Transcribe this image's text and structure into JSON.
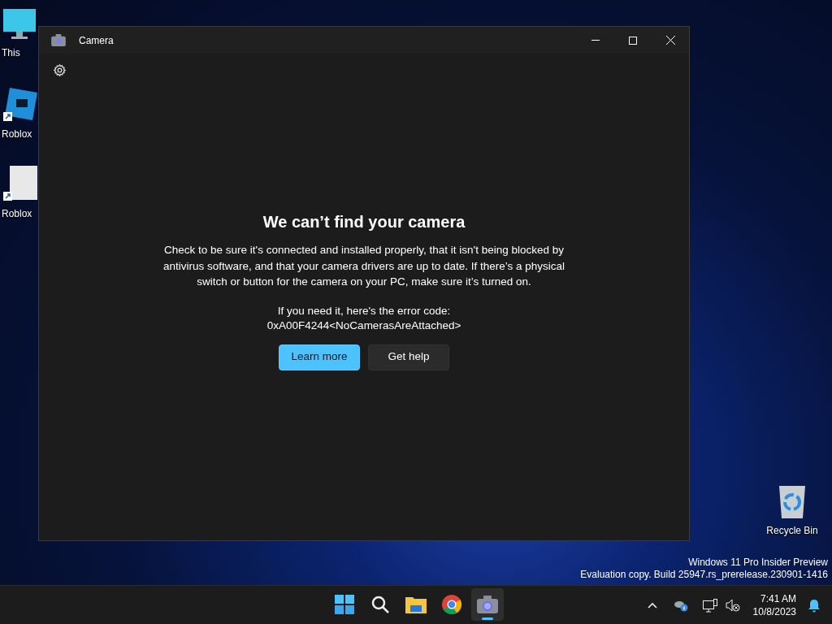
{
  "desktop_icons": [
    {
      "kind": "computer",
      "label": "This"
    },
    {
      "kind": "studio",
      "label": "Roblox"
    },
    {
      "kind": "player",
      "label": "Roblox"
    },
    {
      "kind": "bin",
      "label": "Recycle Bin"
    }
  ],
  "window": {
    "title": "Camera",
    "error": {
      "heading": "We can’t find your camera",
      "message": "Check to be sure it's connected and installed properly, that it isn't being blocked by antivirus software, and that your camera drivers are up to date. If there’s a physical switch or button for the camera on your PC, make sure it’s turned on.",
      "code_intro": "If you need it, here's the error code:",
      "code": "0xA00F4244<NoCamerasAreAttached>"
    },
    "buttons": [
      {
        "kind": "primary",
        "label": "Learn more"
      },
      {
        "kind": "secondary",
        "label": "Get help"
      }
    ]
  },
  "watermark": [
    "Windows 11 Pro Insider Preview",
    "Evaluation copy. Build 25947.rs_prerelease.230901-1416"
  ],
  "taskbar": {
    "items": [
      {
        "kind": "start",
        "selected": false
      },
      {
        "kind": "search",
        "selected": false
      },
      {
        "kind": "explorer",
        "selected": false
      },
      {
        "kind": "browser",
        "selected": false
      },
      {
        "kind": "camera",
        "selected": true
      }
    ],
    "time": "7:41 AM",
    "date": "10/8/2023"
  }
}
